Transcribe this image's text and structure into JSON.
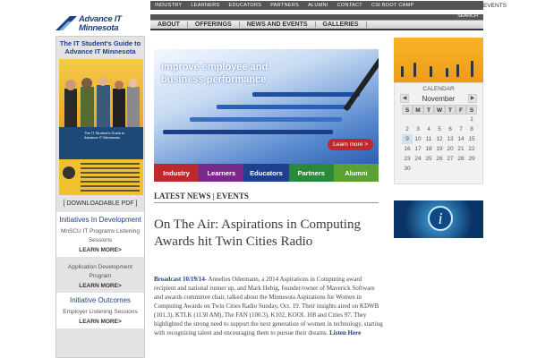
{
  "topnav": [
    "INDUSTRY",
    "LEARNERS",
    "EDUCATORS",
    "PARTNERS",
    "ALUMNI",
    "CONTACT",
    "CSI BOOT CAMP"
  ],
  "events_tab": "EVENTS",
  "logo": {
    "line1": "Advance IT",
    "line2": "Minnesota"
  },
  "search_label": "SEARCH",
  "mainnav": [
    "ABOUT",
    "OFFERINGS",
    "NEWS AND EVENTS",
    "GALLERIES"
  ],
  "sidebar": {
    "guide_title": "The IT Student's Guide to Advance IT Minnesota",
    "guide_overlay": "The IT Student's Guide to Advance IT Minnesota",
    "download": "[ DOWNLOADABLE PDF ]",
    "initiatives_head": "Initiatives In Development",
    "initiatives_item": "MnSCU IT Programs Listening Sessions",
    "more1": "LEARN MORE>",
    "app_dev": "Application Development Program",
    "more2": "LEARN MORE>",
    "outcomes_head": "Initiative Outcomes",
    "outcomes_item": "Employer Listening Sessions",
    "more3": "LEARN MORE>"
  },
  "hero": {
    "line1": "Improve employee and",
    "line2": "business performance",
    "button": "Learn more >"
  },
  "categories": [
    {
      "label": "Industry",
      "color": "#c0282d"
    },
    {
      "label": "Learners",
      "color": "#7a2a8a"
    },
    {
      "label": "Educators",
      "color": "#1f3f8f"
    },
    {
      "label": "Partners",
      "color": "#2a8a3a"
    },
    {
      "label": "Alumni",
      "color": "#5aa032"
    }
  ],
  "news_head": "LATEST NEWS | EVENTS",
  "article": {
    "title": "On The Air: Aspirations in Computing Awards hit Twin Cities Radio",
    "dateline": "Broadcast 10/19/14",
    "body": "- Annelies Odermann, a 2014 Aspirations in Computing award recipient and national runner up, and Mark Hebig, founder/owner of Maverick Software and awards committee chair, talked about the Minnesota Aspirations for Women in Computing Awards on Twin Cities Radio Sunday, Oct. 19. Their insights aired on KDWB (101.3), KTLK (1130 AM), The FAN (100.3), K102, KOOL 108 and Cities 97. They highlighted the strong need to support the next generation of women in technology, starting with recognizing talent and encouraging them to pursue their dreams. ",
    "listen": "Listen Here"
  },
  "calendar": {
    "title": "CALENDAR",
    "prev": "◀",
    "month": "November",
    "next": "▶",
    "days": [
      "S",
      "M",
      "T",
      "W",
      "T",
      "F",
      "S"
    ],
    "rows": [
      [
        "",
        "",
        "",
        "",
        "",
        "",
        "1"
      ],
      [
        "2",
        "3",
        "4",
        "5",
        "6",
        "7",
        "8"
      ],
      [
        "9",
        "10",
        "11",
        "12",
        "13",
        "14",
        "15"
      ],
      [
        "16",
        "17",
        "18",
        "19",
        "20",
        "21",
        "22"
      ],
      [
        "23",
        "24",
        "25",
        "26",
        "27",
        "28",
        "29"
      ],
      [
        "30",
        "",
        "",
        "",
        "",
        "",
        ""
      ]
    ],
    "today": "9"
  },
  "info_icon": "i"
}
